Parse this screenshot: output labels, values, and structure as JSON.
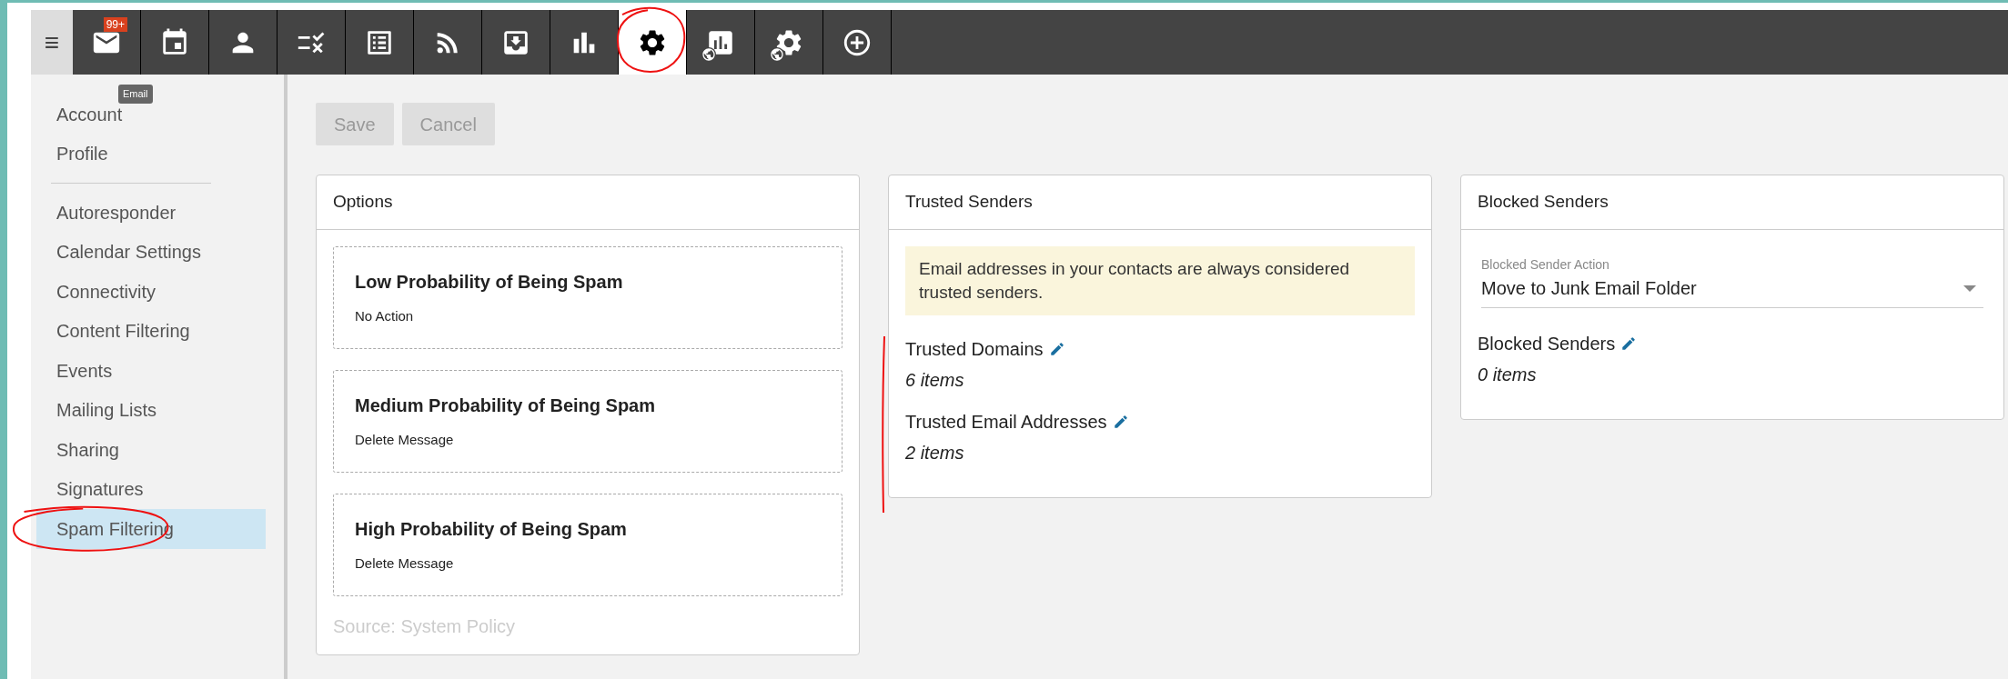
{
  "toolbar": {
    "menu_label": "≡",
    "tabs": [
      {
        "kind": "mail",
        "selected": false,
        "badge": "99+",
        "circled": false
      },
      {
        "kind": "calendar",
        "selected": false,
        "circled": false
      },
      {
        "kind": "contact",
        "selected": false,
        "circled": false
      },
      {
        "kind": "tasks",
        "selected": false,
        "circled": false
      },
      {
        "kind": "notes",
        "selected": false,
        "circled": false
      },
      {
        "kind": "feed",
        "selected": false,
        "circled": false
      },
      {
        "kind": "inbox",
        "selected": false,
        "circled": false
      },
      {
        "kind": "chart",
        "selected": false,
        "circled": false
      },
      {
        "kind": "settings",
        "selected": true,
        "circled": true
      },
      {
        "kind": "report-globe",
        "selected": false,
        "circled": false
      },
      {
        "kind": "settings-globe",
        "selected": false,
        "circled": false
      },
      {
        "kind": "add",
        "selected": false,
        "circled": false
      }
    ],
    "tooltip": "Email"
  },
  "sidebar": {
    "groups": [
      [
        {
          "label": "Account",
          "selected": false,
          "circled": false
        },
        {
          "label": "Profile",
          "selected": false,
          "circled": false
        }
      ],
      [
        {
          "label": "Autoresponder",
          "selected": false,
          "circled": false
        },
        {
          "label": "Calendar Settings",
          "selected": false,
          "circled": false
        },
        {
          "label": "Connectivity",
          "selected": false,
          "circled": false
        },
        {
          "label": "Content Filtering",
          "selected": false,
          "circled": false
        },
        {
          "label": "Events",
          "selected": false,
          "circled": false
        },
        {
          "label": "Mailing Lists",
          "selected": false,
          "circled": false
        },
        {
          "label": "Sharing",
          "selected": false,
          "circled": false
        },
        {
          "label": "Signatures",
          "selected": false,
          "circled": false
        },
        {
          "label": "Spam Filtering",
          "selected": true,
          "circled": true
        }
      ]
    ]
  },
  "actions": [
    {
      "label": "Save",
      "disabled": true
    },
    {
      "label": "Cancel",
      "disabled": true
    }
  ],
  "options": {
    "title": "Options",
    "items": [
      {
        "title": "Low Probability of Being Spam",
        "action": "No Action"
      },
      {
        "title": "Medium Probability of Being Spam",
        "action": "Delete Message"
      },
      {
        "title": "High Probability of Being Spam",
        "action": "Delete Message"
      }
    ],
    "source": "Source: System Policy"
  },
  "trusted": {
    "title": "Trusted Senders",
    "marked": true,
    "notice": "Email addresses in your contacts are always considered trusted senders.",
    "lists": [
      {
        "label": "Trusted Domains",
        "count": "6 items"
      },
      {
        "label": "Trusted Email Addresses",
        "count": "2 items"
      }
    ]
  },
  "blocked": {
    "title": "Blocked Senders",
    "action_field": {
      "label": "Blocked Sender Action",
      "value": "Move to Junk Email Folder"
    },
    "lists": [
      {
        "label": "Blocked Senders",
        "count": "0 items"
      }
    ]
  }
}
